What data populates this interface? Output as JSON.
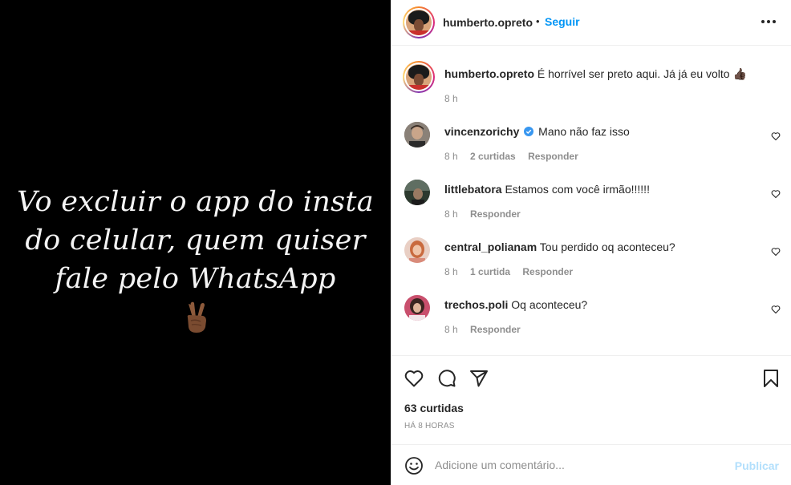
{
  "post": {
    "image_text": "Vo excluir o app do insta do celular, quem quiser fale pelo WhatsApp",
    "image_emoji": "victory-hand-emoji"
  },
  "header": {
    "username": "humberto.opreto",
    "dot": "•",
    "follow_label": "Seguir",
    "more_icon": "more-options-icon"
  },
  "caption": {
    "username": "humberto.opreto",
    "text": "É horrível ser preto aqui. Já já eu volto 👍🏿",
    "time": "8 h"
  },
  "comments": [
    {
      "username": "vincenzorichy",
      "verified": true,
      "text": "Mano não faz isso",
      "time": "8 h",
      "likes": "2 curtidas",
      "reply": "Responder"
    },
    {
      "username": "littlebatora",
      "verified": false,
      "text": "Estamos com você irmão!!!!!!",
      "time": "8 h",
      "likes": "",
      "reply": "Responder"
    },
    {
      "username": "central_polianam",
      "verified": false,
      "text": "Tou perdido oq aconteceu?",
      "time": "8 h",
      "likes": "1 curtida",
      "reply": "Responder"
    },
    {
      "username": "trechos.poli",
      "verified": false,
      "text": "Oq aconteceu?",
      "time": "8 h",
      "likes": "",
      "reply": "Responder"
    }
  ],
  "actions": {
    "like_icon": "heart-icon",
    "comment_icon": "comment-icon",
    "share_icon": "send-icon",
    "save_icon": "bookmark-icon",
    "likes_count": "63 curtidas",
    "posted_ago": "HÁ 8 HORAS"
  },
  "composer": {
    "emoji_icon": "smiley-icon",
    "placeholder": "Adicione um comentário...",
    "publish_label": "Publicar"
  },
  "colors": {
    "accent": "#0095f6",
    "publish_disabled": "#b2dffc",
    "secondary_text": "#8e8e8e",
    "border": "#efefef",
    "verified": "#3897f0"
  }
}
